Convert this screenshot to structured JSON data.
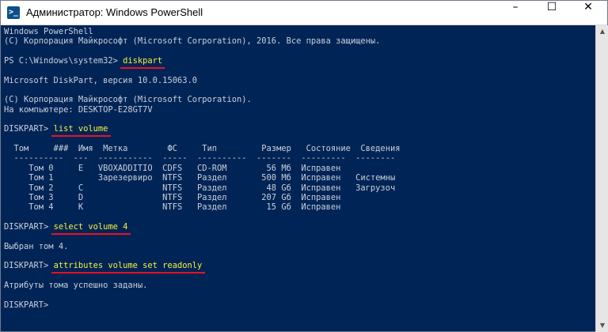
{
  "window": {
    "title": "Администратор: Windows PowerShell",
    "icon_name": "powershell-icon",
    "buttons": {
      "minimize": "–",
      "maximize": "☐",
      "close": "✕"
    }
  },
  "console": {
    "lines": [
      {
        "text": "Windows PowerShell"
      },
      {
        "text": "(C) Корпорация Майкрософт (Microsoft Corporation), 2016. Все права защищены."
      },
      {
        "text": ""
      },
      {
        "text": "PS C:\\Windows\\system32> ",
        "command": "diskpart"
      },
      {
        "text": ""
      },
      {
        "text": "Microsoft DiskPart, версия 10.0.15063.0"
      },
      {
        "text": ""
      },
      {
        "text": "(C) Корпорация Майкрософт (Microsoft Corporation)."
      },
      {
        "text": "На компьютере: DESKTOP-E28GT7V"
      },
      {
        "text": ""
      },
      {
        "text": "DISKPART> ",
        "command": "list volume"
      },
      {
        "text": ""
      },
      {
        "text": "  Том     ###  Имя  Метка        ФС     Тип         Размер   Состояние  Сведения"
      },
      {
        "text": "  ----------  ---  -----------  -----  ----------  -------  ---------  --------"
      },
      {
        "text": "     Том 0     E   VBOXADDITIO  CDFS   CD-ROM        56 Мб  Исправен"
      },
      {
        "text": "     Том 1         Зарезервиро  NTFS   Раздел       500 Мб  Исправен   Системны"
      },
      {
        "text": "     Том 2     C                NTFS   Раздел        48 Gб  Исправен   Загрузоч"
      },
      {
        "text": "     Том 3     D                NTFS   Раздел       207 Gб  Исправен"
      },
      {
        "text": "     Том 4     K                NTFS   Раздел        15 Gб  Исправен"
      },
      {
        "text": ""
      },
      {
        "text": "DISKPART> ",
        "command": "select volume 4"
      },
      {
        "text": ""
      },
      {
        "text": "Выбран том 4."
      },
      {
        "text": ""
      },
      {
        "text": "DISKPART> ",
        "command": "attributes volume set readonly"
      },
      {
        "text": ""
      },
      {
        "text": "Атрибуты тома успешно заданы."
      },
      {
        "text": ""
      },
      {
        "text": "DISKPART> "
      }
    ]
  },
  "colors": {
    "console_background": "#012456",
    "console_text": "#c9d1da",
    "command_text": "#f7f13c",
    "underline": "#e81123"
  }
}
